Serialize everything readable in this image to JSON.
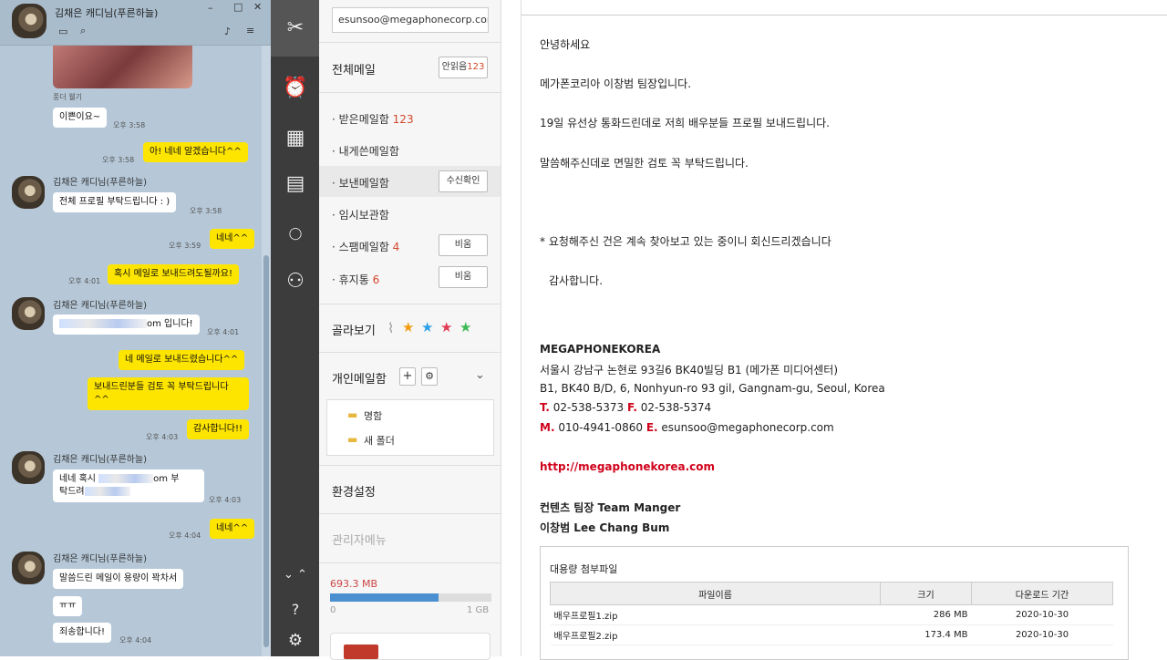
{
  "chat": {
    "title": "김채은 캐디님(푸른하늘)",
    "messages": {
      "m0_caption": "풍더 웰기",
      "m1_text": "이쁜이요~",
      "m1_time": "오후 3:58",
      "m2_text": "아! 네네 알겠습니다^^",
      "m2_time": "오후 3:58",
      "m3_name": "김채은 캐디님(푸른하늘)",
      "m3_text": "전체 프로필 부탁드립니다 : )",
      "m3_time": "오후 3:58",
      "m4_text": "네네^^",
      "m4_time": "오후 3:59",
      "m5_text": "혹시 메일로 보내드려도될까요!",
      "m5_time": "오후 4:01",
      "m6_name": "김채은 캐디님(푸른하늘)",
      "m6_text_suffix": "om 입니다!",
      "m6_time": "오후 4:01",
      "m7_text": "네 메일로 보내드렸습니다^^",
      "m8_text": "보내드린분들 검토 꼭 부탁드립니다 ^^",
      "m9_text": "감사합니다!!",
      "m9_time": "오후 4:03",
      "m10_name": "김채은 캐디님(푸른하늘)",
      "m10_text_a": "네네 혹시 ",
      "m10_text_b": "om 부",
      "m10_text_c": "탁드려",
      "m10_time": "오후 4:03",
      "m11_text": "네네^^",
      "m11_time": "오후 4:04",
      "m12_name": "김채은 캐디님(푸른하늘)",
      "m12_text": "말씀드린 메일이 용량이 꽉차서",
      "m13_text": "ㅠㅠ",
      "m14_text": "죄송합니다!",
      "m14_time": "오후 4:04"
    }
  },
  "nav": {
    "email": "esunsoo@megaphonecorp.com",
    "all_mail": "전체메일",
    "unread_label": "안읽음",
    "unread_count": "123",
    "inbox": "받은메일함",
    "inbox_count": "123",
    "tome": "내게쓴메일함",
    "sent": "보낸메일함",
    "receipt_btn": "수신확인",
    "draft": "임시보관함",
    "spam": "스팸메일함",
    "spam_count": "4",
    "empty_btn": "비움",
    "trash": "휴지통",
    "trash_count": "6",
    "filter": "골라보기",
    "personal": "개인메일함",
    "folder1": "명함",
    "folder2": "새 폴더",
    "settings": "환경설정",
    "admin": "관리자메뉴",
    "quota_used": "693.3 MB",
    "quota_fraction": 0.67,
    "quota_min": "0",
    "quota_max": "1 GB"
  },
  "mail": {
    "l1": "안녕하세요",
    "l2": "메가폰코리아 이창범 팀장입니다.",
    "l3": "19일 유선상 통화드린데로 저희 배우분들 프로필 보내드립니다.",
    "l4": "말씀해주신데로 면밀한 검토 꼭 부탁드립니다.",
    "l5": "* 요청해주신 건은 계속 찾아보고 있는 중이니 회신드리겠습니다",
    "l6": "감사합니다.",
    "company": "MEGAPHONEKOREA",
    "addr1": "서울시 강남구 논현로 93길6 BK40빌딩 B1 (메가폰 미디어센터)",
    "addr2": "B1, BK40 B/D, 6, Nonhyun-ro 93 gil, Gangnam-gu, Seoul, Korea",
    "t_label": "T.",
    "phone": "02-538-5373",
    "f_label": "F.",
    "fax": "02-538-5374",
    "m_label": "M.",
    "mobile": "010-4941-0860",
    "e_label": "E.",
    "email": "esunsoo@megaphonecorp.com",
    "url": "http://megaphonekorea.com",
    "title1": "컨텐츠 팀장 Team Manger",
    "title2": "이창범 Lee Chang Bum",
    "attach_title": "대용량 첨부파일",
    "col_name": "파일이름",
    "col_size": "크기",
    "col_period": "다운로드 기간",
    "files": [
      {
        "name": "배우프로필1.zip",
        "size": "286 MB",
        "period": "2020-10-30"
      },
      {
        "name": "배우프로필2.zip",
        "size": "173.4 MB",
        "period": "2020-10-30"
      }
    ]
  }
}
